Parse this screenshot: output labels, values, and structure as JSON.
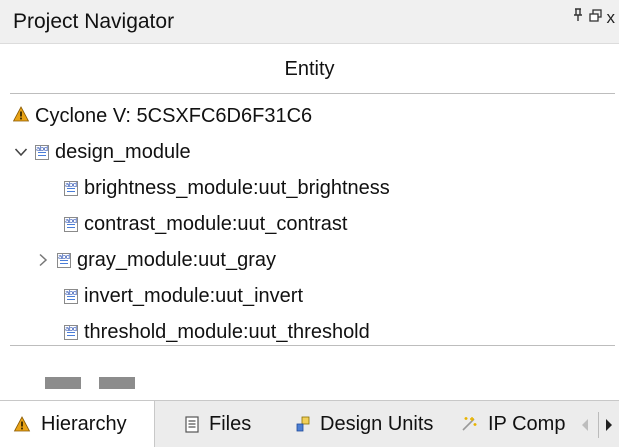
{
  "panel": {
    "title": "Project Navigator",
    "controls": {
      "pin": "⍑",
      "float": "⧉",
      "close": "x"
    }
  },
  "column_header": "Entity",
  "tree": [
    {
      "label": "Cyclone V: 5CSXFC6D6F31C6",
      "icon": "warning-icon",
      "level": 0,
      "toggle": "none"
    },
    {
      "label": "design_module",
      "icon": "abd-icon",
      "level": 0,
      "toggle": "expanded"
    },
    {
      "label": "brightness_module:uut_brightness",
      "icon": "abd-icon",
      "level": 1,
      "toggle": "none"
    },
    {
      "label": "contrast_module:uut_contrast",
      "icon": "abd-icon",
      "level": 1,
      "toggle": "none"
    },
    {
      "label": "gray_module:uut_gray",
      "icon": "abd-icon",
      "level": 1,
      "toggle": "collapsed"
    },
    {
      "label": "invert_module:uut_invert",
      "icon": "abd-icon",
      "level": 1,
      "toggle": "none"
    },
    {
      "label": "threshold_module:uut_threshold",
      "icon": "abd-icon",
      "level": 1,
      "toggle": "none"
    }
  ],
  "tabs": [
    {
      "label": "Hierarchy",
      "icon": "hierarchy-icon",
      "active": true
    },
    {
      "label": "Files",
      "icon": "files-icon",
      "active": false
    },
    {
      "label": "Design Units",
      "icon": "design-units-icon",
      "active": false
    },
    {
      "label": "IP Comp",
      "icon": "ip-components-icon",
      "active": false
    }
  ],
  "colors": {
    "warning": "#e8a317",
    "selection_bg": "#ffffff",
    "tabbar_bg": "#ececec"
  }
}
